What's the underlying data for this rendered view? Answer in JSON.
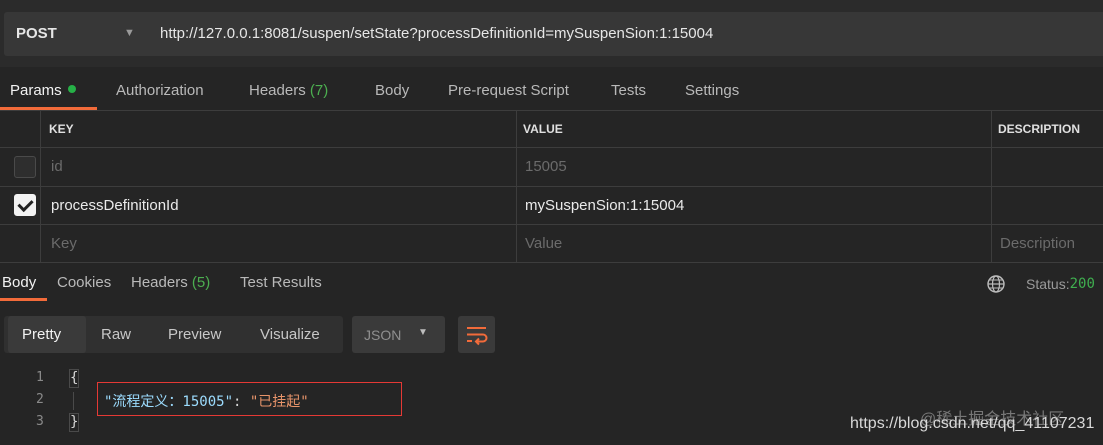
{
  "request": {
    "method": "POST",
    "url": "http://127.0.0.1:8081/suspen/setState?processDefinitionId=mySuspenSion:1:15004"
  },
  "request_tabs": [
    {
      "label": "Params",
      "active": true
    },
    {
      "label": "Authorization"
    },
    {
      "label": "Headers",
      "count": "(7)"
    },
    {
      "label": "Body"
    },
    {
      "label": "Pre-request Script"
    },
    {
      "label": "Tests"
    },
    {
      "label": "Settings"
    }
  ],
  "params_table": {
    "headers": [
      "KEY",
      "VALUE",
      "DESCRIPTION"
    ],
    "rows": [
      {
        "checked": false,
        "key": "id",
        "value": "15005",
        "description": ""
      },
      {
        "checked": true,
        "key": "processDefinitionId",
        "value": "mySuspenSion:1:15004",
        "description": ""
      }
    ],
    "placeholders": {
      "key": "Key",
      "value": "Value",
      "description": "Description"
    }
  },
  "response_tabs": [
    {
      "label": "Body",
      "active": true
    },
    {
      "label": "Cookies"
    },
    {
      "label": "Headers",
      "count": "(5)"
    },
    {
      "label": "Test Results"
    }
  ],
  "status": {
    "label": "Status:",
    "code": "200"
  },
  "view_modes": [
    "Pretty",
    "Raw",
    "Preview",
    "Visualize"
  ],
  "format": "JSON",
  "code": {
    "line_numbers": [
      "1",
      "2",
      "3"
    ],
    "open_brace": "{",
    "close_brace": "}",
    "key": "\"流程定义：15005\"",
    "colon": ": ",
    "value": "\"已挂起\""
  },
  "watermark": {
    "url": "https://blog.csdn.net/qq_41107231",
    "brand": "@稀土掘金技术社区"
  },
  "colors": {
    "accent": "#f26b3a",
    "success": "#26b047",
    "highlight_box": "#e53935"
  },
  "icons": [
    "chevron-down-icon",
    "checkbox-checked-icon",
    "globe-icon",
    "wrap-lines-icon"
  ]
}
